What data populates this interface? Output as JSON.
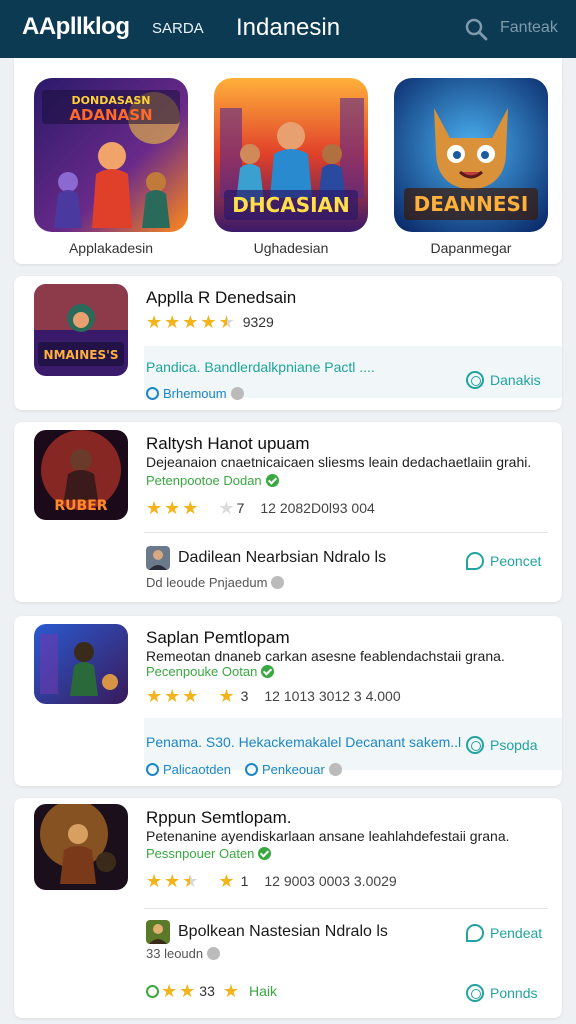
{
  "header": {
    "brand": "AApllklog",
    "tab": "SARDA",
    "title": "Indanesin",
    "search_label": "Fanteak"
  },
  "featured": [
    {
      "label": "Applakadesin",
      "art_text": "DONDASASN ADANASN"
    },
    {
      "label": "Ughadesian",
      "art_text": "DHCASIAN"
    },
    {
      "label": "Dapanmegar",
      "art_text": "DEANNESI"
    }
  ],
  "apps": [
    {
      "title": "Applla R Denedsain",
      "rating_value": "9329",
      "art_text": "NMAINES'S",
      "link_text": "Pandica. Bandlerdalkpniane Pactl  ....",
      "action_label": "Danakis",
      "meta_label": "Brhemoum"
    },
    {
      "title": "Raltysh Hanot upuam",
      "description": "Dejeanaion cnaetnicaicaen sliesms leain dedachaetlaiin grahi.",
      "developer": "Petenpootoe Dodan",
      "rating_value": "7",
      "rating_extra": "12 2082D0l93 004",
      "art_text": "RUBER",
      "user_name": "Dadilean Nearbsian Ndralo  ls",
      "action_label": "Peoncet",
      "meta_label": "Dd leoude  Pnjaedum"
    },
    {
      "title": "Saplan Pemtlopam",
      "description": "Remeotan dnaneb carkan asesne feablendachstaii grana.",
      "developer": "Pecenpouke Ootan",
      "rating_value": "3",
      "rating_extra": "12 1013 3012 3 4.000",
      "art_text": "",
      "link_text": "Penama. S30. Hekackemakalel Decanant sakem..l",
      "action_label": "Psopda",
      "meta_label": "Palicaotden",
      "meta_label_2": "Penkeouar"
    },
    {
      "title": "Rppun Semtlopam.",
      "description": "Petenanine ayendiskarlaan ansane leahlahdefestaii grana.",
      "developer": "Pessnpouer Oaten",
      "rating_value": "1",
      "rating_extra": "12 9003 0003 3.0029",
      "art_text": "",
      "user_name": "Bpolkean Nastesian Ndralo  ls",
      "action_label": "Pendeat",
      "meta_label": "33 leoudn",
      "footer_rating": "33",
      "footer_link": "Haik",
      "footer_action": "Ponnds"
    }
  ],
  "colors": {
    "header_bg": "#0c3a52",
    "accent": "#22a3a0",
    "link": "#1c86c9",
    "verified": "#39a840",
    "star": "#f3b31a"
  }
}
